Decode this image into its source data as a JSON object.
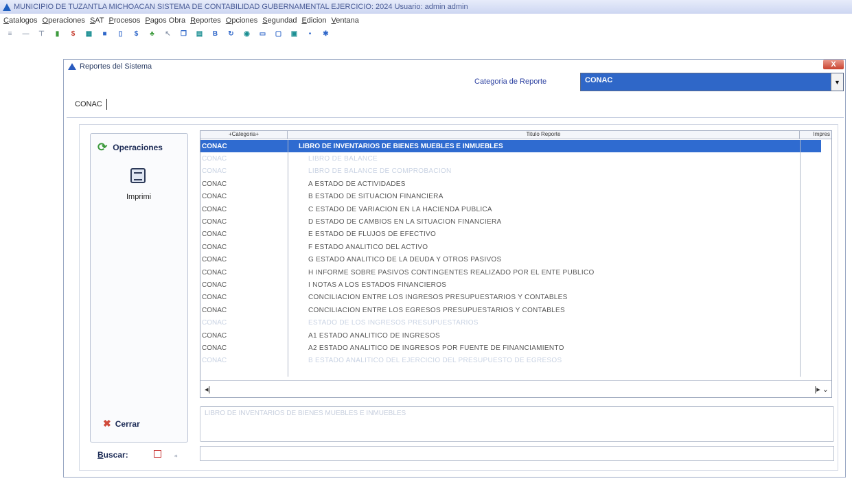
{
  "app": {
    "title": "MUNICIPIO DE TUZANTLA MICHOACAN SISTEMA DE CONTABILIDAD GUBERNAMENTAL EJERCICIO: 2024 Usuario: admin admin"
  },
  "menu": {
    "items": [
      "Catalogos",
      "Operaciones",
      "SAT",
      "Procesos",
      "Pagos Obra",
      "Reportes",
      "Opciones",
      "Segundad",
      "Edicion",
      "Ventana"
    ]
  },
  "toolbar": {
    "icons": [
      "list-icon",
      "minus-icon",
      "tree-icon",
      "chart-icon",
      "dollar-icon",
      "calc-icon",
      "briefcase-icon",
      "document-icon",
      "money-icon",
      "leaf-icon",
      "cursor-icon",
      "copy-icon",
      "table-icon",
      "bold-icon",
      "refresh-icon",
      "globe-icon",
      "monitor-icon",
      "folder-icon",
      "window-icon",
      "save-icon",
      "star-icon"
    ]
  },
  "window": {
    "title": "Reportes del Sistema",
    "close_label": "X",
    "category_label": "Categoria de Reporte",
    "category_value": "CONAC",
    "current_category": "CONAC"
  },
  "operations": {
    "title": "Operaciones",
    "print_label": "Imprimi",
    "close_label": "Cerrar"
  },
  "grid": {
    "columns": [
      "+Categoria+",
      "Titulo Reporte",
      "Impres"
    ],
    "rows": [
      {
        "category": "CONAC",
        "title": "LIBRO DE INVENTARIOS DE BIENES MUEBLES E INMUEBLES",
        "state": "selected"
      },
      {
        "category": "CONAC",
        "title": "LIBRO DE BALANCE",
        "state": "faint"
      },
      {
        "category": "CONAC",
        "title": "LIBRO DE BALANCE DE COMPROBACION",
        "state": "faint"
      },
      {
        "category": "CONAC",
        "title": "A ESTADO DE ACTIVIDADES",
        "state": ""
      },
      {
        "category": "CONAC",
        "title": "B ESTADO DE SITUACION FINANCIERA",
        "state": ""
      },
      {
        "category": "CONAC",
        "title": "C ESTADO DE VARIACION EN LA HACIENDA PUBLICA",
        "state": ""
      },
      {
        "category": "CONAC",
        "title": "D ESTADO DE CAMBIOS EN LA SITUACION FINANCIERA",
        "state": ""
      },
      {
        "category": "CONAC",
        "title": "E ESTADO DE FLUJOS DE EFECTIVO",
        "state": ""
      },
      {
        "category": "CONAC",
        "title": "F ESTADO ANALITICO DEL ACTIVO",
        "state": ""
      },
      {
        "category": "CONAC",
        "title": "G ESTADO ANALITICO DE LA DEUDA Y OTROS PASIVOS",
        "state": ""
      },
      {
        "category": "CONAC",
        "title": "H INFORME SOBRE PASIVOS CONTINGENTES REALIZADO POR EL ENTE PUBLICO",
        "state": ""
      },
      {
        "category": "CONAC",
        "title": "I NOTAS A LOS ESTADOS FINANCIEROS",
        "state": ""
      },
      {
        "category": "CONAC",
        "title": "CONCILIACION ENTRE LOS INGRESOS PRESUPUESTARIOS Y CONTABLES",
        "state": ""
      },
      {
        "category": "CONAC",
        "title": "CONCILIACION ENTRE LOS EGRESOS PRESUPUESTARIOS Y CONTABLES",
        "state": ""
      },
      {
        "category": "CONAC",
        "title": "ESTADO DE LOS INGRESOS PRESUPUESTARIOS",
        "state": "faint"
      },
      {
        "category": "CONAC",
        "title": "A1 ESTADO ANALITICO DE INGRESOS",
        "state": ""
      },
      {
        "category": "CONAC",
        "title": "A2 ESTADO ANALITICO DE INGRESOS POR FUENTE DE FINANCIAMIENTO",
        "state": ""
      },
      {
        "category": "CONAC",
        "title": "B ESTADO ANALITICO DEL EJERCICIO DEL PRESUPUESTO DE EGRESOS",
        "state": "faint"
      }
    ]
  },
  "description": "LIBRO DE INVENTARIOS DE BIENES MUEBLES E INMUEBLES",
  "search": {
    "label": "Buscar:",
    "value": ""
  },
  "colors": {
    "selection": "#2f6bd0",
    "titlebar": "#cdd6f2",
    "label_accent": "#2a3fa0"
  }
}
